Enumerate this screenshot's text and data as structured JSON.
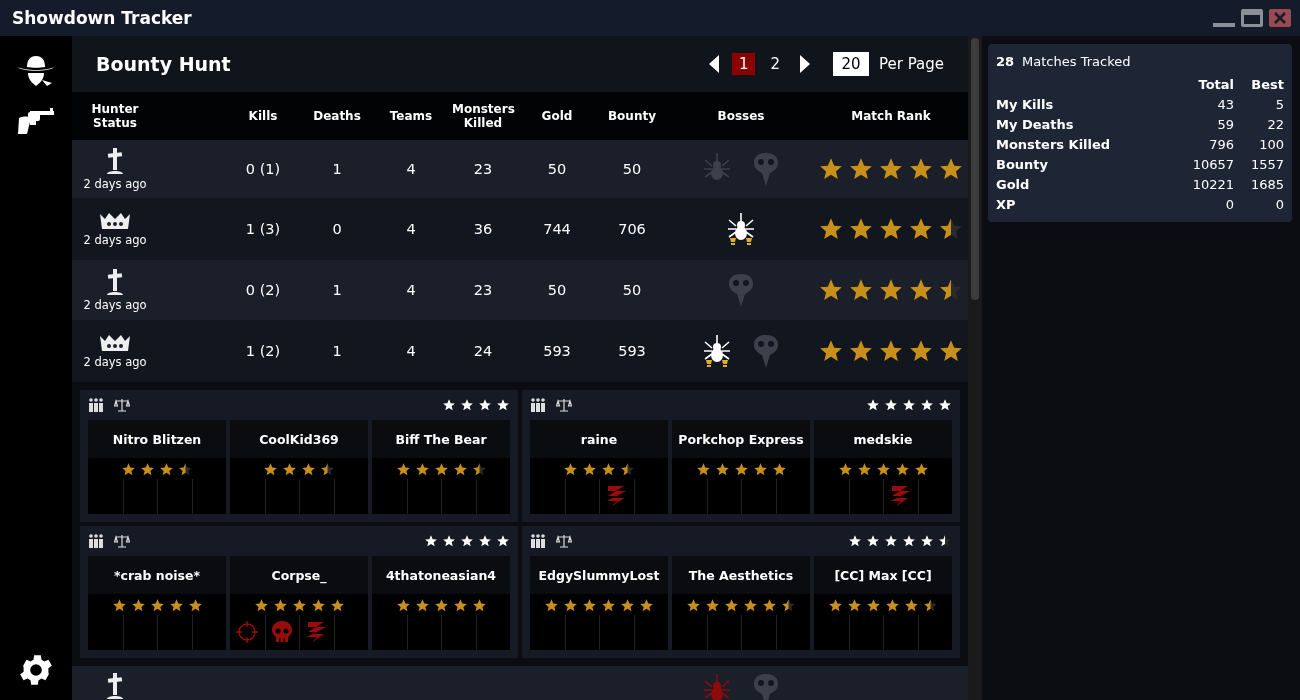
{
  "window": {
    "title": "Showdown Tracker"
  },
  "sidebar": {
    "items": [
      {
        "kind": "hunter"
      },
      {
        "kind": "revolver"
      }
    ],
    "footer": {
      "kind": "settings"
    }
  },
  "page": {
    "title": "Bounty Hunt"
  },
  "pagination": {
    "pages": [
      {
        "label": "1",
        "selected": true
      },
      {
        "label": "2",
        "selected": false
      }
    ],
    "per_page": "20",
    "per_page_label": "Per Page"
  },
  "table": {
    "columns": [
      "Hunter Status",
      "Kills",
      "Deaths",
      "Teams",
      "Monsters Killed",
      "Gold",
      "Bounty",
      "Bosses",
      "Match Rank"
    ],
    "rows": [
      {
        "kind": "dead",
        "time": "2 days ago",
        "kills": "0 (1)",
        "deaths": "1",
        "teams": "4",
        "monsters": "23",
        "gold": "50",
        "bounty": "50",
        "bosses": [
          {
            "kind": "spider",
            "killed": false,
            "marked": false
          },
          {
            "kind": "butcher",
            "killed": false,
            "marked": false
          }
        ],
        "stars": 5
      },
      {
        "kind": "extracted",
        "time": "2 days ago",
        "kills": "1 (3)",
        "deaths": "0",
        "teams": "4",
        "monsters": "36",
        "gold": "744",
        "bounty": "706",
        "bosses": [
          {
            "kind": "spider",
            "killed": true,
            "marked": false
          }
        ],
        "stars": 4.5
      },
      {
        "kind": "dead",
        "time": "2 days ago",
        "kills": "0 (2)",
        "deaths": "1",
        "teams": "4",
        "monsters": "23",
        "gold": "50",
        "bounty": "50",
        "bosses": [
          {
            "kind": "butcher",
            "killed": false,
            "marked": false
          }
        ],
        "stars": 4.5
      },
      {
        "kind": "extracted",
        "time": "2 days ago",
        "kills": "1 (2)",
        "deaths": "1",
        "teams": "4",
        "monsters": "24",
        "gold": "593",
        "bounty": "593",
        "bosses": [
          {
            "kind": "spider",
            "killed": true,
            "marked": false
          },
          {
            "kind": "butcher",
            "killed": false,
            "marked": false
          }
        ],
        "stars": 5
      }
    ],
    "teams": [
      {
        "stars": 4,
        "players": [
          {
            "name": "Nitro Blitzen",
            "stars": 3.5
          },
          {
            "name": "CoolKid369",
            "stars": 3.5
          },
          {
            "name": "Biff The Bear",
            "stars": 4.5
          }
        ]
      },
      {
        "stars": 5,
        "players": [
          {
            "name": "raine",
            "stars": 3.5,
            "badges": [
              {
                "kind": "lightning"
              }
            ]
          },
          {
            "name": "Porkchop Express",
            "stars": 5
          },
          {
            "name": "medskie",
            "stars": 5,
            "badges": [
              {
                "kind": "lightning"
              }
            ]
          }
        ]
      },
      {
        "stars": 5,
        "players": [
          {
            "name": "*crab noise*",
            "stars": 5
          },
          {
            "name": "Corpse_",
            "stars": 5,
            "badges": [
              {
                "kind": "crosshair"
              },
              {
                "kind": "skull"
              },
              {
                "kind": "lightning"
              }
            ]
          },
          {
            "name": "4thatoneasian4",
            "stars": 5
          }
        ]
      },
      {
        "stars": 5.5,
        "players": [
          {
            "name": "EdgySlummyLost",
            "stars": 6
          },
          {
            "name": "The Aesthetics",
            "stars": 5.5
          },
          {
            "name": "[CC] Max [CC]",
            "stars": 5.5
          }
        ]
      }
    ],
    "next_row": {
      "kind": "dead",
      "bosses": [
        {
          "kind": "spider",
          "killed": false,
          "marked": true
        },
        {
          "kind": "butcher",
          "killed": false,
          "marked": false
        }
      ]
    }
  },
  "summary": {
    "count": "28",
    "label": "Matches Tracked",
    "columns": [
      "Total",
      "Best"
    ],
    "rows": [
      {
        "label": "My Kills",
        "total": "43",
        "best": "5"
      },
      {
        "label": "My Deaths",
        "total": "59",
        "best": "22"
      },
      {
        "label": "Monsters Killed",
        "total": "796",
        "best": "100"
      },
      {
        "label": "Bounty",
        "total": "10657",
        "best": "1557"
      },
      {
        "label": "Gold",
        "total": "10221",
        "best": "1685"
      },
      {
        "label": "XP",
        "total": "0",
        "best": "0"
      }
    ]
  }
}
